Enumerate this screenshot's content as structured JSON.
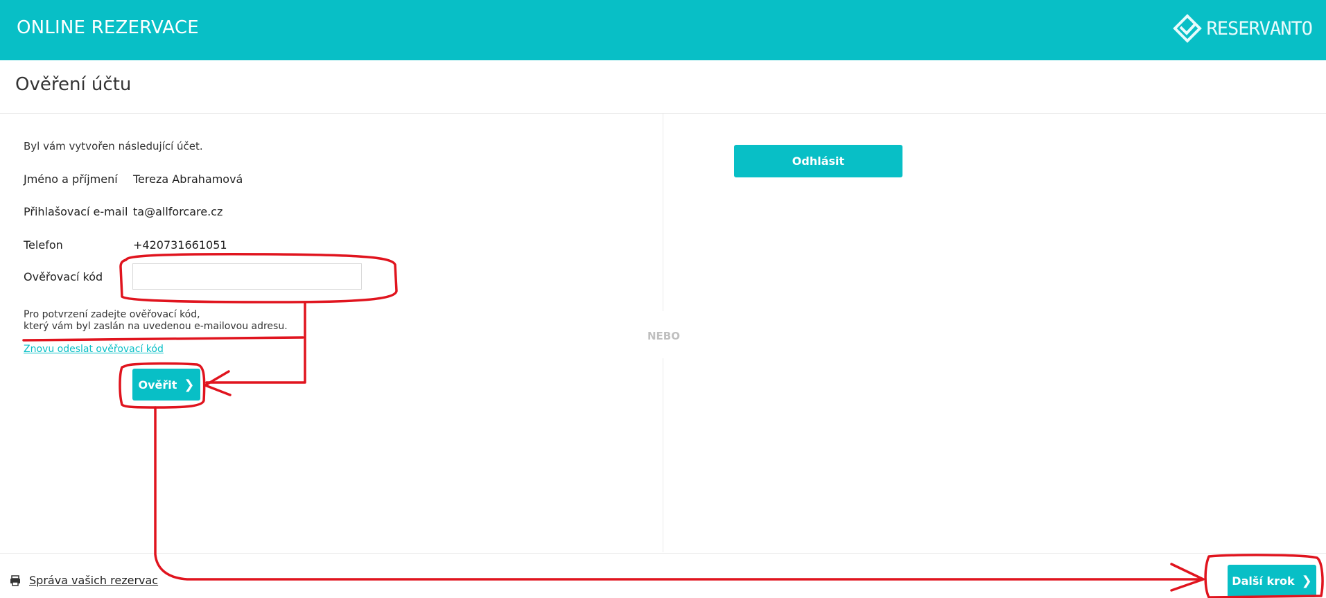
{
  "header": {
    "app_title": "ONLINE REZERVACE",
    "brand_name": "RESERVANTO",
    "brand_logo_icon": "diamond-logo-icon"
  },
  "page": {
    "title": "Ověření účtu"
  },
  "account": {
    "intro": "Byl vám vytvořen následující účet.",
    "rows": [
      {
        "label": "Jméno a příjmení",
        "value": "Tereza Abrahamová"
      },
      {
        "label": "Přihlašovací e-mail",
        "value": "ta@allforcare.cz"
      },
      {
        "label": "Telefon",
        "value": "+420731661051"
      }
    ],
    "code_label": "Ověřovací kód",
    "code_value": "",
    "code_placeholder": "",
    "hint_line1": "Pro potvrzení zadejte ověřovací kód,",
    "hint_line2": "který vám byl zaslán na uvedenou e-mailovou adresu.",
    "resend_label": "Znovu odeslat ověřovací kód",
    "verify_label": "Ověřit"
  },
  "separator": {
    "text": "NEBO"
  },
  "right_panel": {
    "logout_label": "Odhlásit"
  },
  "footer": {
    "manage_label": "Správa vašich rezervac",
    "manage_icon": "printer-icon",
    "next_label": "Další krok"
  },
  "colors": {
    "accent": "#08bfc6",
    "annotation": "#e0141e"
  }
}
